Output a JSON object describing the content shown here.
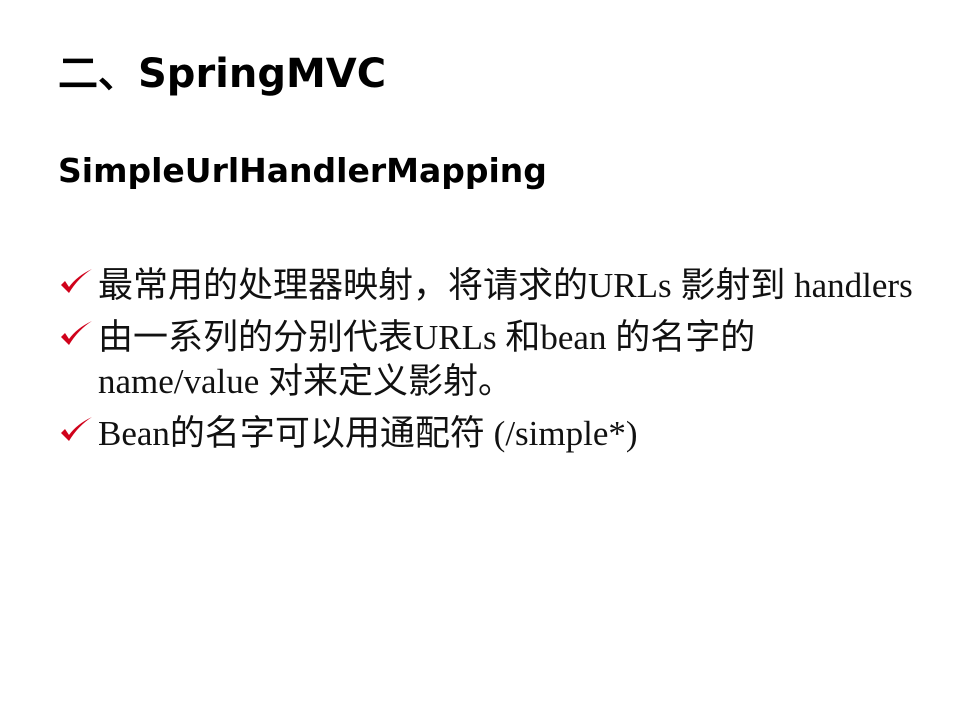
{
  "slide": {
    "title": "二、SpringMVC",
    "subtitle": "SimpleUrlHandlerMapping",
    "bullet_icon": "checkmark-icon",
    "bullet_color": "#d0021b",
    "bullets": [
      {
        "text": "最常用的处理器映射，将请求的URLs 影射到 handlers"
      },
      {
        "text": "由一系列的分别代表URLs 和bean 的名字的 name/value 对来定义影射。"
      },
      {
        "text": "Bean的名字可以用通配符 (/simple*)"
      }
    ]
  }
}
